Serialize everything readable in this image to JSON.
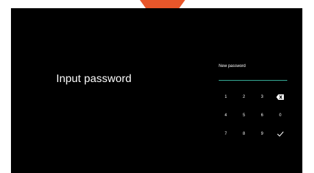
{
  "screen": {
    "title": "Input password",
    "field_label": "New password",
    "arrow_color": "#e8562a",
    "underline_color": "#3ab5a0"
  },
  "keypad": {
    "rows": [
      [
        "1",
        "2",
        "3",
        "backspace-icon"
      ],
      [
        "4",
        "5",
        "6",
        "0"
      ],
      [
        "7",
        "8",
        "9",
        "checkmark-icon"
      ]
    ]
  }
}
